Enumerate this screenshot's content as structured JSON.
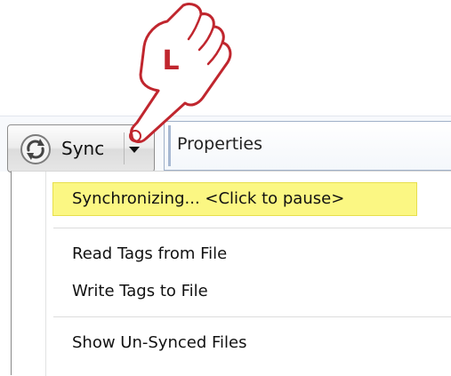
{
  "toolbar": {
    "sync_label": "Sync",
    "properties_label": "Properties"
  },
  "cursor": {
    "badge": "L",
    "icon": "hand-pointer-icon",
    "badge_color": "#c0262e"
  },
  "menu": {
    "items": [
      {
        "label": "Synchronizing... <Click to pause>",
        "highlighted": true
      },
      {
        "label": "Read Tags from File"
      },
      {
        "label": "Write Tags to File"
      },
      {
        "label": "Show Un-Synced Files"
      }
    ],
    "highlight_color": "#fbf783"
  },
  "colors": {
    "accent_red": "#c0262e",
    "toolbar_border": "#9fb0c8"
  }
}
